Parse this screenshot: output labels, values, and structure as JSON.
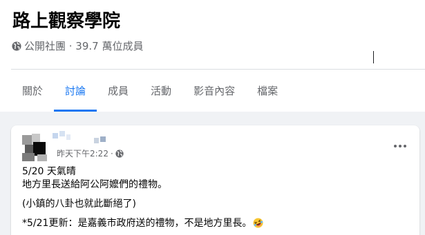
{
  "group": {
    "name": "路上觀察學院",
    "meta": "公開社團 · 39.7 萬位成員",
    "meta_icon": "globe-icon"
  },
  "tabs": [
    {
      "label": "關於",
      "active": false
    },
    {
      "label": "討論",
      "active": true
    },
    {
      "label": "成員",
      "active": false
    },
    {
      "label": "活動",
      "active": false
    },
    {
      "label": "影音內容",
      "active": false
    },
    {
      "label": "檔案",
      "active": false
    }
  ],
  "post": {
    "timestamp": "昨天下午2:22",
    "separator": "·",
    "privacy_icon": "globe-icon",
    "more_icon": "more-options-icon",
    "lines": [
      "5/20 天氣晴",
      "地方里長送給阿公阿嬤們的禮物。",
      "(小鎮的八卦也就此斷絕了)",
      "*5/21更新：是嘉義市政府送的禮物，不是地方里長。"
    ],
    "emoji_icon": "rolling-laughing-emoji-icon"
  },
  "colors": {
    "accent": "#1877f2",
    "secondary_text": "#65676b",
    "background": "#f0f2f5"
  }
}
